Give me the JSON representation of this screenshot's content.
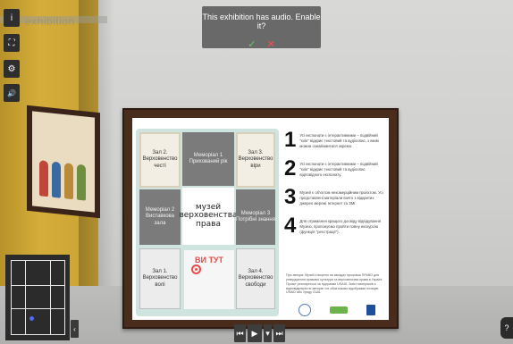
{
  "audio_prompt": {
    "text": "This exhibition has audio. Enable it?",
    "confirm_icon": "check-icon",
    "deny_icon": "x-icon",
    "confirm_symbol": "✓",
    "deny_symbol": "✕"
  },
  "toolbar": {
    "info_symbol": "i",
    "fullscreen_symbol": "⛶",
    "settings_symbol": "⚙",
    "audio_symbol": "🔊"
  },
  "background_text": "exhibition",
  "exhibit": {
    "plan": {
      "top_left": "Зал 2.\nВерховенство\nчесті",
      "top_center": "Меморіал 1\nПрихований рік",
      "top_right": "Зал 3.\nВерховенство\nвіри",
      "mid_left": "Меморіал 2\nВиставкова зала",
      "mid_right": "Меморіал 3\nПотрібні знання",
      "bottom_left": "Зал 1.\nВерховенство\nволі",
      "bottom_right": "Зал 4.\nВерховенство\nсвободи",
      "title_lines": [
        "музей",
        "верховенства",
        "права"
      ],
      "you_are_here": "ВИ ТУТ"
    },
    "rules": [
      {
        "num": "1",
        "text": "Усі експонати є інтерактивними – подвійний \"клік\" відкриє текстовий та аудіоопис, з яким можна ознайомитися окремо."
      },
      {
        "num": "2",
        "text": "Усі експонати є інтерактивними – подвійний \"клік\" відкриє текстовий та аудіоопис відповідного експонату."
      },
      {
        "num": "3",
        "text": "Музей є об'єктом некомерційним проєктом. Усі представлені матеріали взято з відкритих джерел мережі Інтернет та ЗМІ."
      },
      {
        "num": "4",
        "text": "Для отримання кращого досвіду відвідування Музею, пропонуємо пройти повну екскурсію (функція \"реєстрації\")."
      }
    ],
    "footer": "Про автора: Музей створено на засадах програми ПРАВО для утвердження правової культури та верховенства права в Україні. Проєкт реалізується за підтримки USAID. Зміст матеріалів є відповідальністю авторів і не обов'язково відображає позицію USAID або Уряду США."
  },
  "controls": {
    "prev_symbol": "⏮",
    "play_symbol": "▶",
    "menu_symbol": "▾",
    "next_symbol": "⏭"
  },
  "minimap_toggle_symbol": "‹",
  "help_symbol": "?"
}
